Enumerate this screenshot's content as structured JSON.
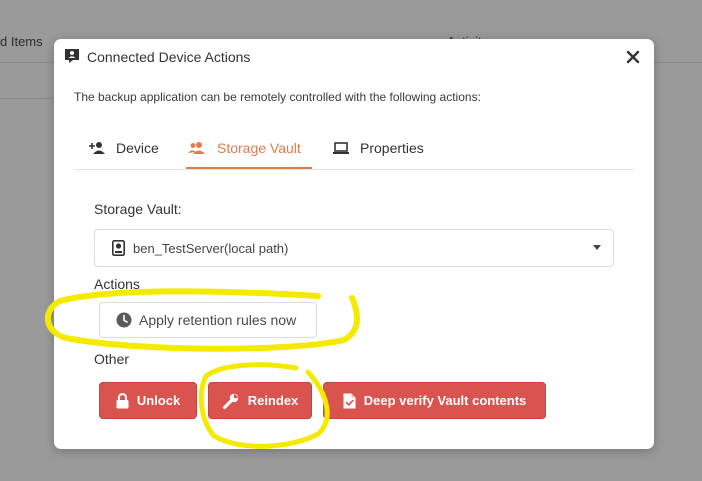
{
  "background": {
    "col_a": "d Items",
    "col_b": "Activity"
  },
  "dialog": {
    "title": "Connected Device Actions",
    "description": "The backup application can be remotely controlled with the following actions:",
    "close_icon": "close-icon"
  },
  "tabs": [
    {
      "label": "Device",
      "icon": "person-add-icon",
      "active": false
    },
    {
      "label": "Storage Vault",
      "icon": "people-icon",
      "active": true
    },
    {
      "label": "Properties",
      "icon": "laptop-icon",
      "active": false
    }
  ],
  "storage_vault": {
    "label": "Storage Vault:",
    "selected": "ben_TestServer(local path)",
    "icon": "hard-drive-icon"
  },
  "actions": {
    "label": "Actions",
    "retention_button": "Apply retention rules now"
  },
  "other": {
    "label": "Other",
    "unlock_button": "Unlock",
    "reindex_button": "Reindex",
    "verify_button": "Deep verify Vault contents"
  },
  "colors": {
    "accent": "#e07b4f",
    "danger": "#d9534f",
    "highlight": "#f4ea00"
  }
}
